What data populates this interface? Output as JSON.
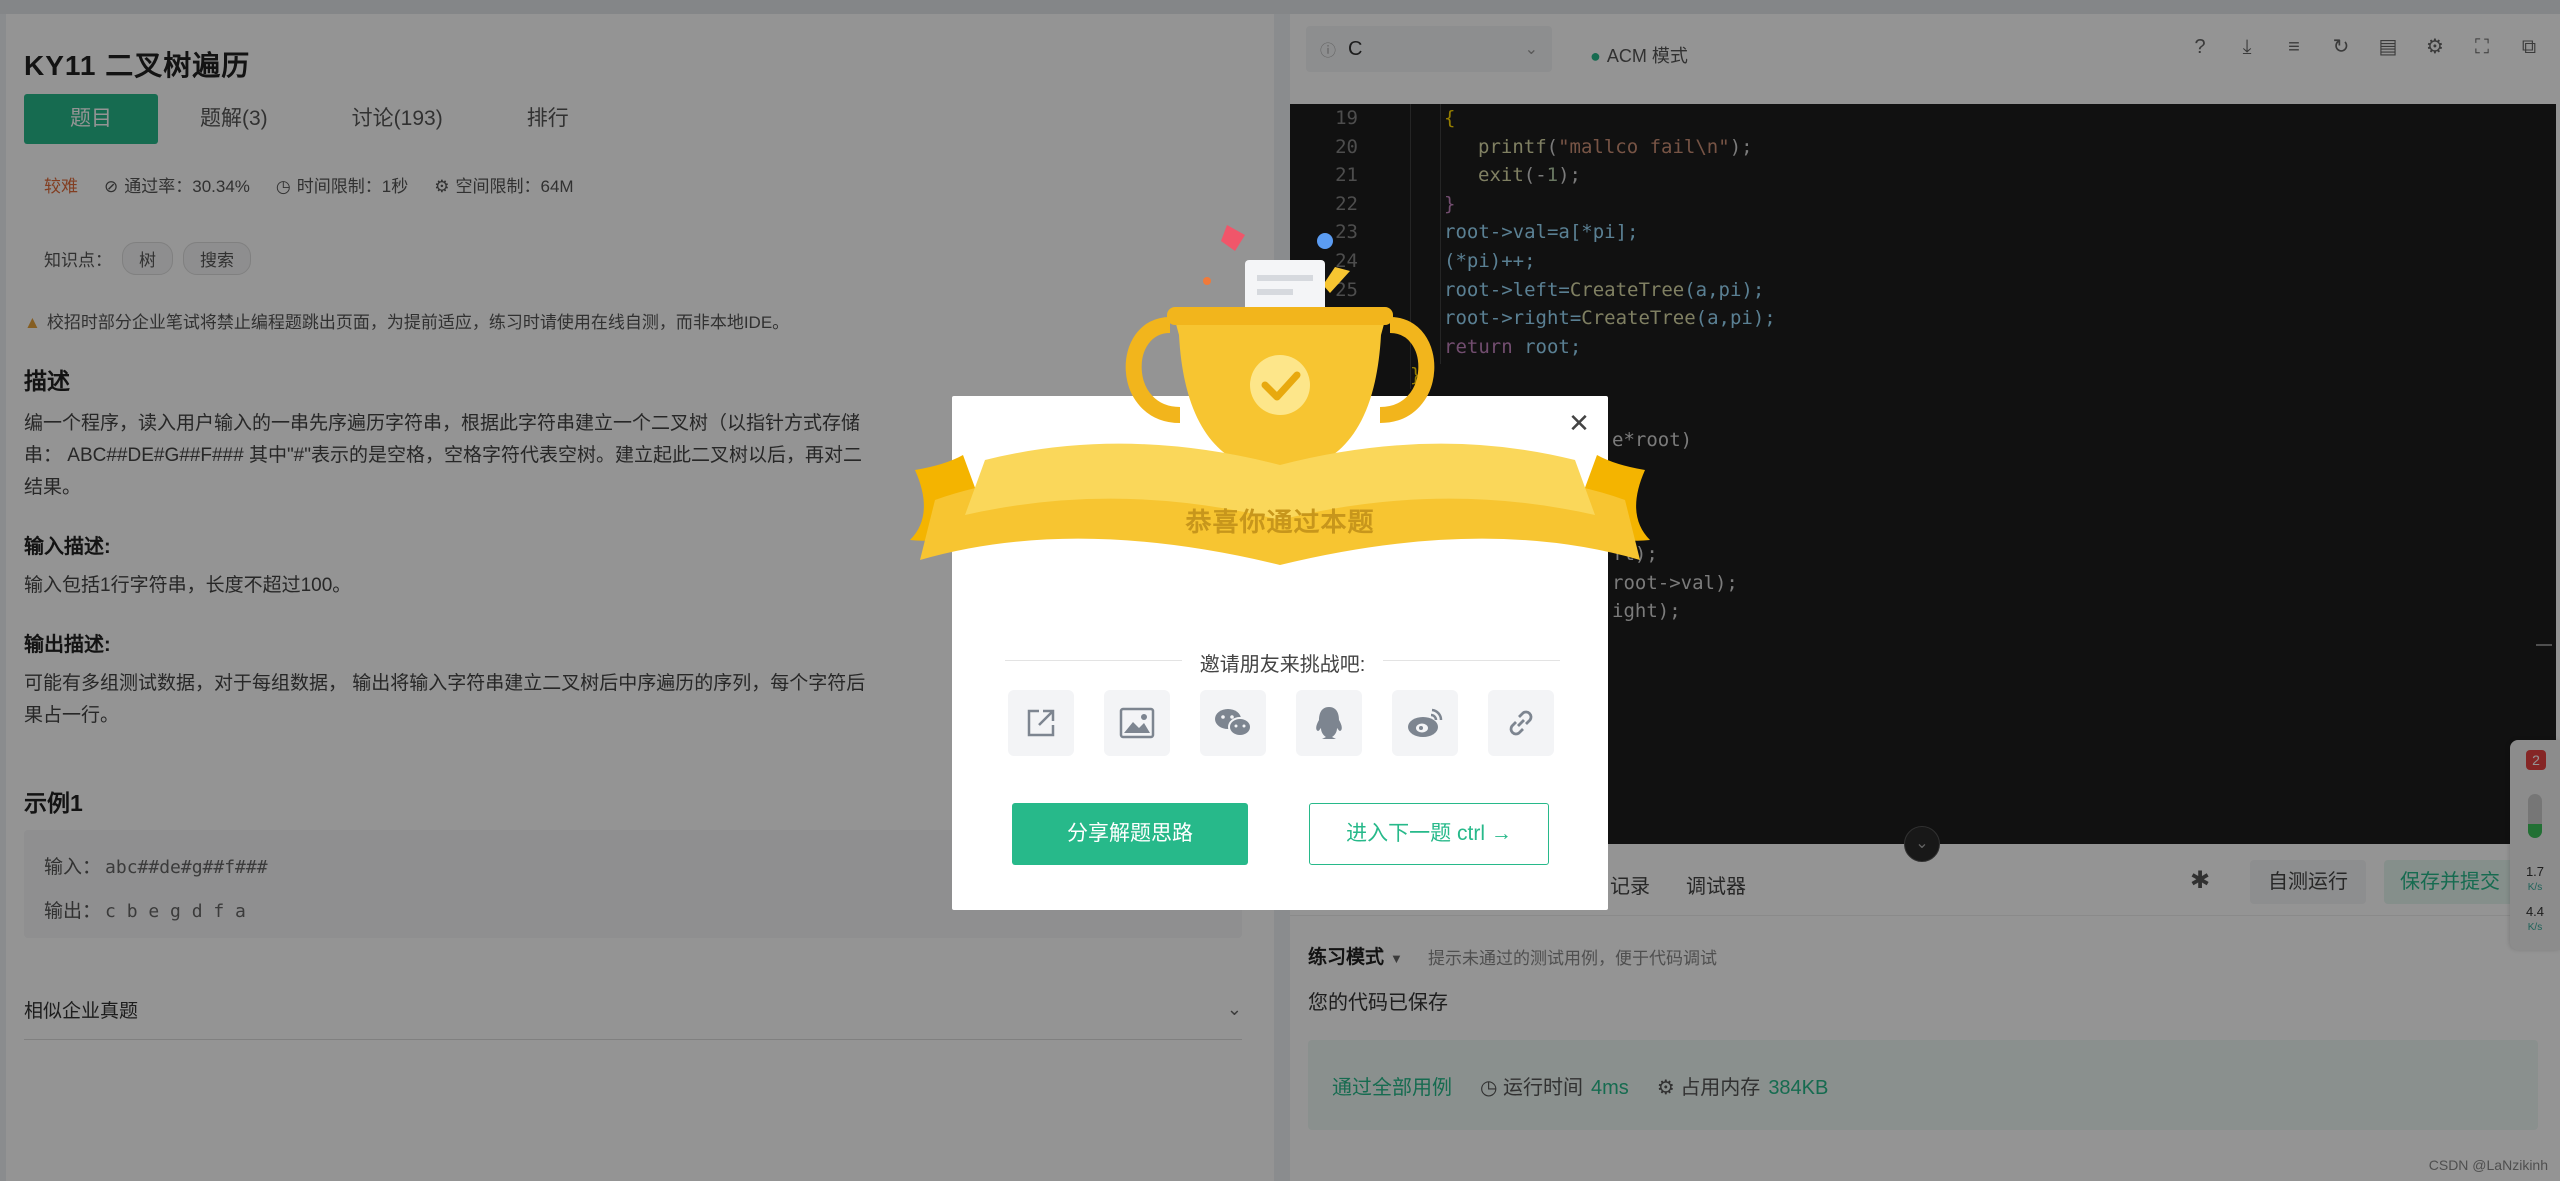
{
  "problem": {
    "title": "KY11  二叉树遍历",
    "tabs": [
      {
        "label": "题目"
      },
      {
        "label": "题解(3)"
      },
      {
        "label": "讨论(193)"
      },
      {
        "label": "排行"
      }
    ],
    "difficulty": "较难",
    "pass_rate": "通过率：30.34%",
    "time_limit": "时间限制：1秒",
    "space_limit": "空间限制：64M",
    "knowledge_label": "知识点：",
    "tags": [
      "树",
      "搜索"
    ],
    "notice": "校招时部分企业笔试将禁止编程题跳出页面，为提前适应，练习时请使用在线自测，而非本地IDE。",
    "desc_title": "描述",
    "desc_lines": [
      "编一个程序，读入用户输入的一串先序遍历字符串，根据此字符串建立一个二叉树（以指针方式存储",
      "串： ABC##DE#G##F### 其中\"#\"表示的是空格，空格字符代表空树。建立起此二叉树以后，再对二",
      "结果。"
    ],
    "input_title": "输入描述:",
    "input_desc": "输入包括1行字符串，长度不超过100。",
    "output_title": "输出描述:",
    "output_lines": [
      "可能有多组测试数据，对于每组数据， 输出将输入字符串建立二叉树后中序遍历的序列，每个字符后",
      "果占一行。"
    ],
    "example_title": "示例1",
    "example_input_label": "输入：",
    "example_input": "abc##de#g##f###",
    "example_output_label": "输出：",
    "example_output": "c b e g d f a",
    "similar_label": "相似企业真题"
  },
  "editor": {
    "language": "C",
    "mode": "ACM 模式",
    "code_lines": [
      {
        "n": "19",
        "tokens": [
          {
            "c": "br",
            "t": "{"
          }
        ]
      },
      {
        "n": "20",
        "tokens": [
          {
            "c": "fn",
            "t": "printf"
          },
          {
            "c": "pl",
            "t": "("
          },
          {
            "c": "str",
            "t": "\"mallco fail\\n\""
          },
          {
            "c": "pl",
            "t": ");"
          }
        ]
      },
      {
        "n": "21",
        "tokens": [
          {
            "c": "fn",
            "t": "exit"
          },
          {
            "c": "pl",
            "t": "(-"
          },
          {
            "c": "num",
            "t": "1"
          },
          {
            "c": "pl",
            "t": ");"
          }
        ]
      },
      {
        "n": "22",
        "tokens": [
          {
            "c": "kw",
            "t": "}"
          }
        ]
      },
      {
        "n": "23",
        "tokens": [
          {
            "c": "tx",
            "t": "root->val=a[*pi];"
          }
        ]
      },
      {
        "n": "24",
        "tokens": [
          {
            "c": "tx",
            "t": "(*pi)++;"
          }
        ]
      },
      {
        "n": "25",
        "tokens": [
          {
            "c": "tx",
            "t": "root->left="
          },
          {
            "c": "fn",
            "t": "CreateTree"
          },
          {
            "c": "tx",
            "t": "(a,pi);"
          }
        ]
      },
      {
        "n": "26",
        "tokens": [
          {
            "c": "tx",
            "t": "root->right="
          },
          {
            "c": "fn",
            "t": "CreateTree"
          },
          {
            "c": "tx",
            "t": "(a,pi);"
          }
        ]
      },
      {
        "n": "27",
        "tokens": [
          {
            "c": "kw",
            "t": "return"
          },
          {
            "c": "tx",
            "t": " root;"
          }
        ]
      },
      {
        "n": "",
        "tokens": [
          {
            "c": "br",
            "t": "}"
          }
        ]
      }
    ],
    "code_fragments": [
      "e*root)",
      "ft);",
      "root->val);",
      "ight);"
    ],
    "tab_records": "记录",
    "tab_debugger": "调试器",
    "run_label": "自测运行",
    "submit_label": "保存并提交",
    "practice_mode": "练习模式",
    "practice_hint": "提示未通过的测试用例，便于代码调试",
    "saved_text": "您的代码已保存",
    "result_pass": "通过全部用例",
    "result_time_label": "运行时间",
    "result_time": "4ms",
    "result_mem_label": "占用内存",
    "result_mem": "384KB"
  },
  "side_widget": {
    "badge": "2",
    "speed_up": "1.7",
    "speed_down": "4.4",
    "unit": "K/s"
  },
  "modal": {
    "congrats": "恭喜你通过本题",
    "invite": "邀请朋友来挑战吧:",
    "share_icons": [
      "share-external-icon",
      "image-icon",
      "wechat-icon",
      "qq-icon",
      "weibo-icon",
      "link-icon"
    ],
    "primary_label": "分享解题思路",
    "next_label": "进入下一题 ctrl",
    "accent": "#27b98a"
  },
  "watermark": "CSDN @LaNzikinh"
}
